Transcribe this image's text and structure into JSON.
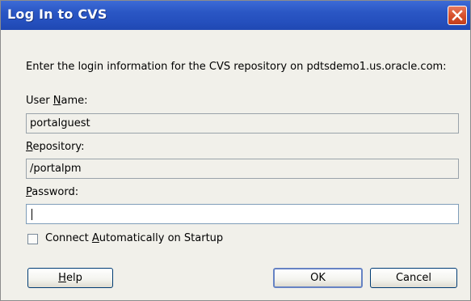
{
  "window": {
    "title": "Log In to CVS"
  },
  "dialog": {
    "prompt": "Enter the login information for the CVS repository on pdtsdemo1.us.oracle.com:",
    "user_name": {
      "label_mnemonic": "N",
      "label_prefix": "User ",
      "label_suffix": "ame:",
      "value": "portalguest"
    },
    "repository": {
      "label_mnemonic": "R",
      "label_suffix": "epository:",
      "value": "/portalpm"
    },
    "password": {
      "label_mnemonic": "P",
      "label_suffix": "assword:",
      "value": ""
    },
    "auto_connect": {
      "label_prefix": "Connect ",
      "label_mnemonic": "A",
      "label_suffix": "utomatically on Startup",
      "checked": false
    }
  },
  "buttons": {
    "help": {
      "mnemonic": "H",
      "suffix": "elp"
    },
    "ok": "OK",
    "cancel": "Cancel"
  },
  "colors": {
    "titlebar": "#2a56c4",
    "close": "#d8512d",
    "dialog_bg": "#f1f0ea"
  }
}
